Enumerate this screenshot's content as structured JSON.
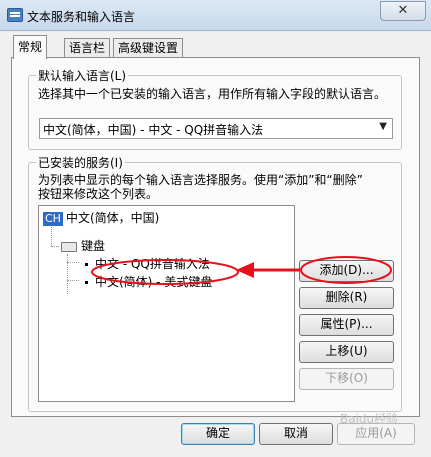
{
  "window": {
    "title": "文本服务和输入语言",
    "close_label": "✕"
  },
  "tabs": [
    {
      "label": "常规",
      "active": true
    },
    {
      "label": "语言栏",
      "active": false
    },
    {
      "label": "高级键设置",
      "active": false
    }
  ],
  "default_language": {
    "group_title": "默认输入语言(L)",
    "description": "选择其中一个已安装的输入语言，用作所有输入字段的默认语言。",
    "selected": "中文(简体，中国) - 中文 - QQ拼音输入法"
  },
  "installed_services": {
    "group_title": "已安装的服务(I)",
    "description_line1": "为列表中显示的每个输入语言选择服务。使用“添加”和“删除”",
    "description_line2": "按钮来修改这个列表。",
    "tree": {
      "language_badge": "CH",
      "language": "中文(简体，中国)",
      "category": "键盘",
      "items": [
        "中文 - QQ拼音输入法",
        "中文(简体) - 美式键盘"
      ]
    },
    "buttons": {
      "add": "添加(D)...",
      "remove": "删除(R)",
      "properties": "属性(P)...",
      "move_up": "上移(U)",
      "move_down": "下移(O)"
    }
  },
  "footer": {
    "ok": "确定",
    "cancel": "取消",
    "apply": "应用(A)"
  },
  "watermark": "Baidu经验",
  "colors": {
    "annotation_red": "#e8101a",
    "badge_blue": "#2d6bc4"
  }
}
